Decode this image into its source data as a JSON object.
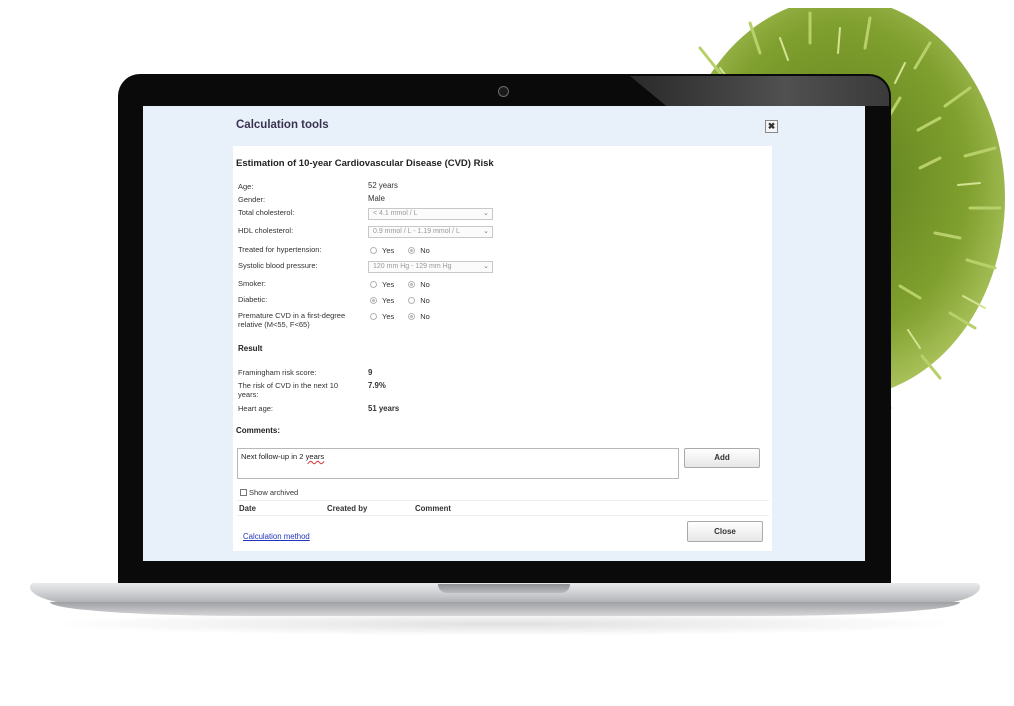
{
  "modal": {
    "title": "Calculation tools",
    "close_glyph": "✖",
    "heading": "Estimation of 10-year Cardiovascular Disease (CVD) Risk"
  },
  "form": {
    "age": {
      "label": "Age:",
      "value": "52 years"
    },
    "gender": {
      "label": "Gender:",
      "value": "Male"
    },
    "total_cholesterol": {
      "label": "Total cholesterol:",
      "selected": "< 4.1 mmol / L"
    },
    "hdl_cholesterol": {
      "label": "HDL cholesterol:",
      "selected": "0.9 mmol / L - 1.19 mmol / L"
    },
    "hypertension": {
      "label": "Treated for hypertension:",
      "yes": "Yes",
      "no": "No",
      "selected": "No"
    },
    "systolic": {
      "label": "Systolic blood pressure:",
      "selected": "120 mm Hg - 129 mm Hg"
    },
    "smoker": {
      "label": "Smoker:",
      "yes": "Yes",
      "no": "No",
      "selected": "No"
    },
    "diabetic": {
      "label": "Diabetic:",
      "yes": "Yes",
      "no": "No",
      "selected": "Yes"
    },
    "premature_cvd": {
      "label_line1": "Premature CVD in a first-degree",
      "label_line2": "relative (M<55, F<65)",
      "yes": "Yes",
      "no": "No",
      "selected": "No"
    }
  },
  "result": {
    "heading": "Result",
    "framingham": {
      "label": "Framingham risk score:",
      "value": "9"
    },
    "risk": {
      "label_line1": "The risk of CVD in the next 10",
      "label_line2": "years:",
      "value": "7.9%"
    },
    "heart_age": {
      "label": "Heart age:",
      "value": "51 years"
    }
  },
  "comments": {
    "label": "Comments:",
    "text_prefix": "Next follow-up in 2 ",
    "text_misspelled": "years",
    "add_button": "Add",
    "show_archived": "Show archived",
    "columns": [
      "Date",
      "Created by",
      "Comment"
    ]
  },
  "footer": {
    "method_link": "Calculation method",
    "close_button": "Close"
  }
}
